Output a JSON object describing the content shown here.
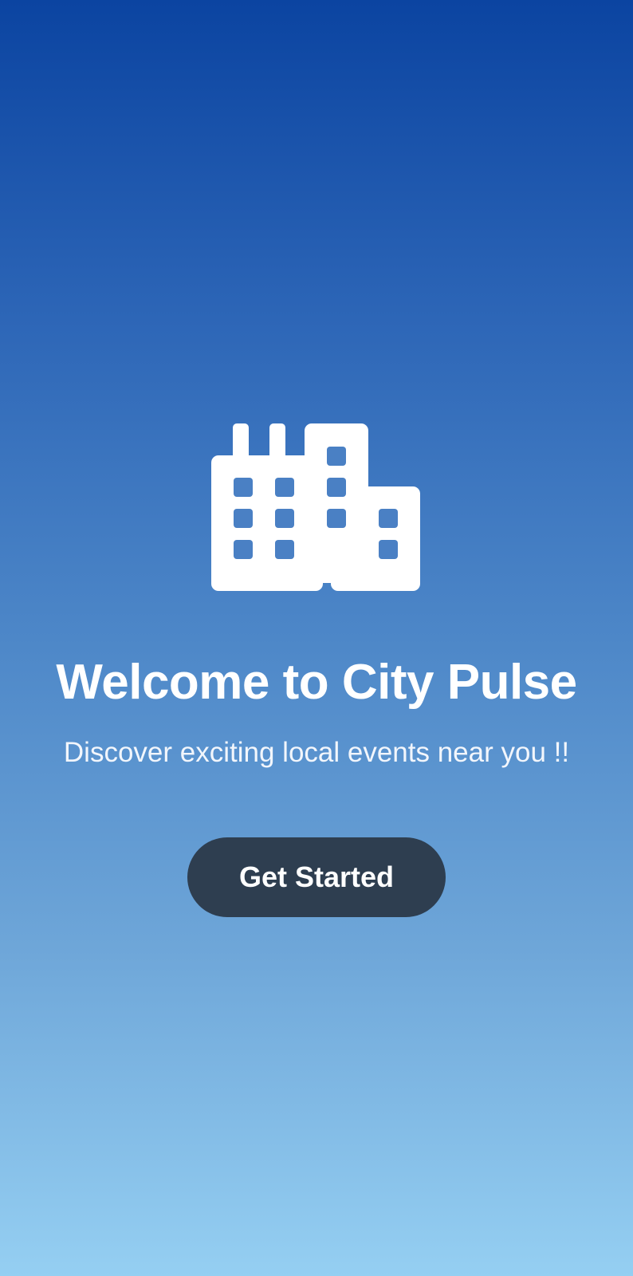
{
  "splash": {
    "logo_icon": "city-buildings-icon",
    "title": "Welcome to City Pulse",
    "subtitle": "Discover exciting local events near you !!",
    "cta_label": "Get Started"
  },
  "colors": {
    "gradient_top": "#0b44a1",
    "gradient_bottom": "#95cff2",
    "button_background": "#2e3e50",
    "icon_window": "#4a80c4",
    "text": "#ffffff"
  }
}
